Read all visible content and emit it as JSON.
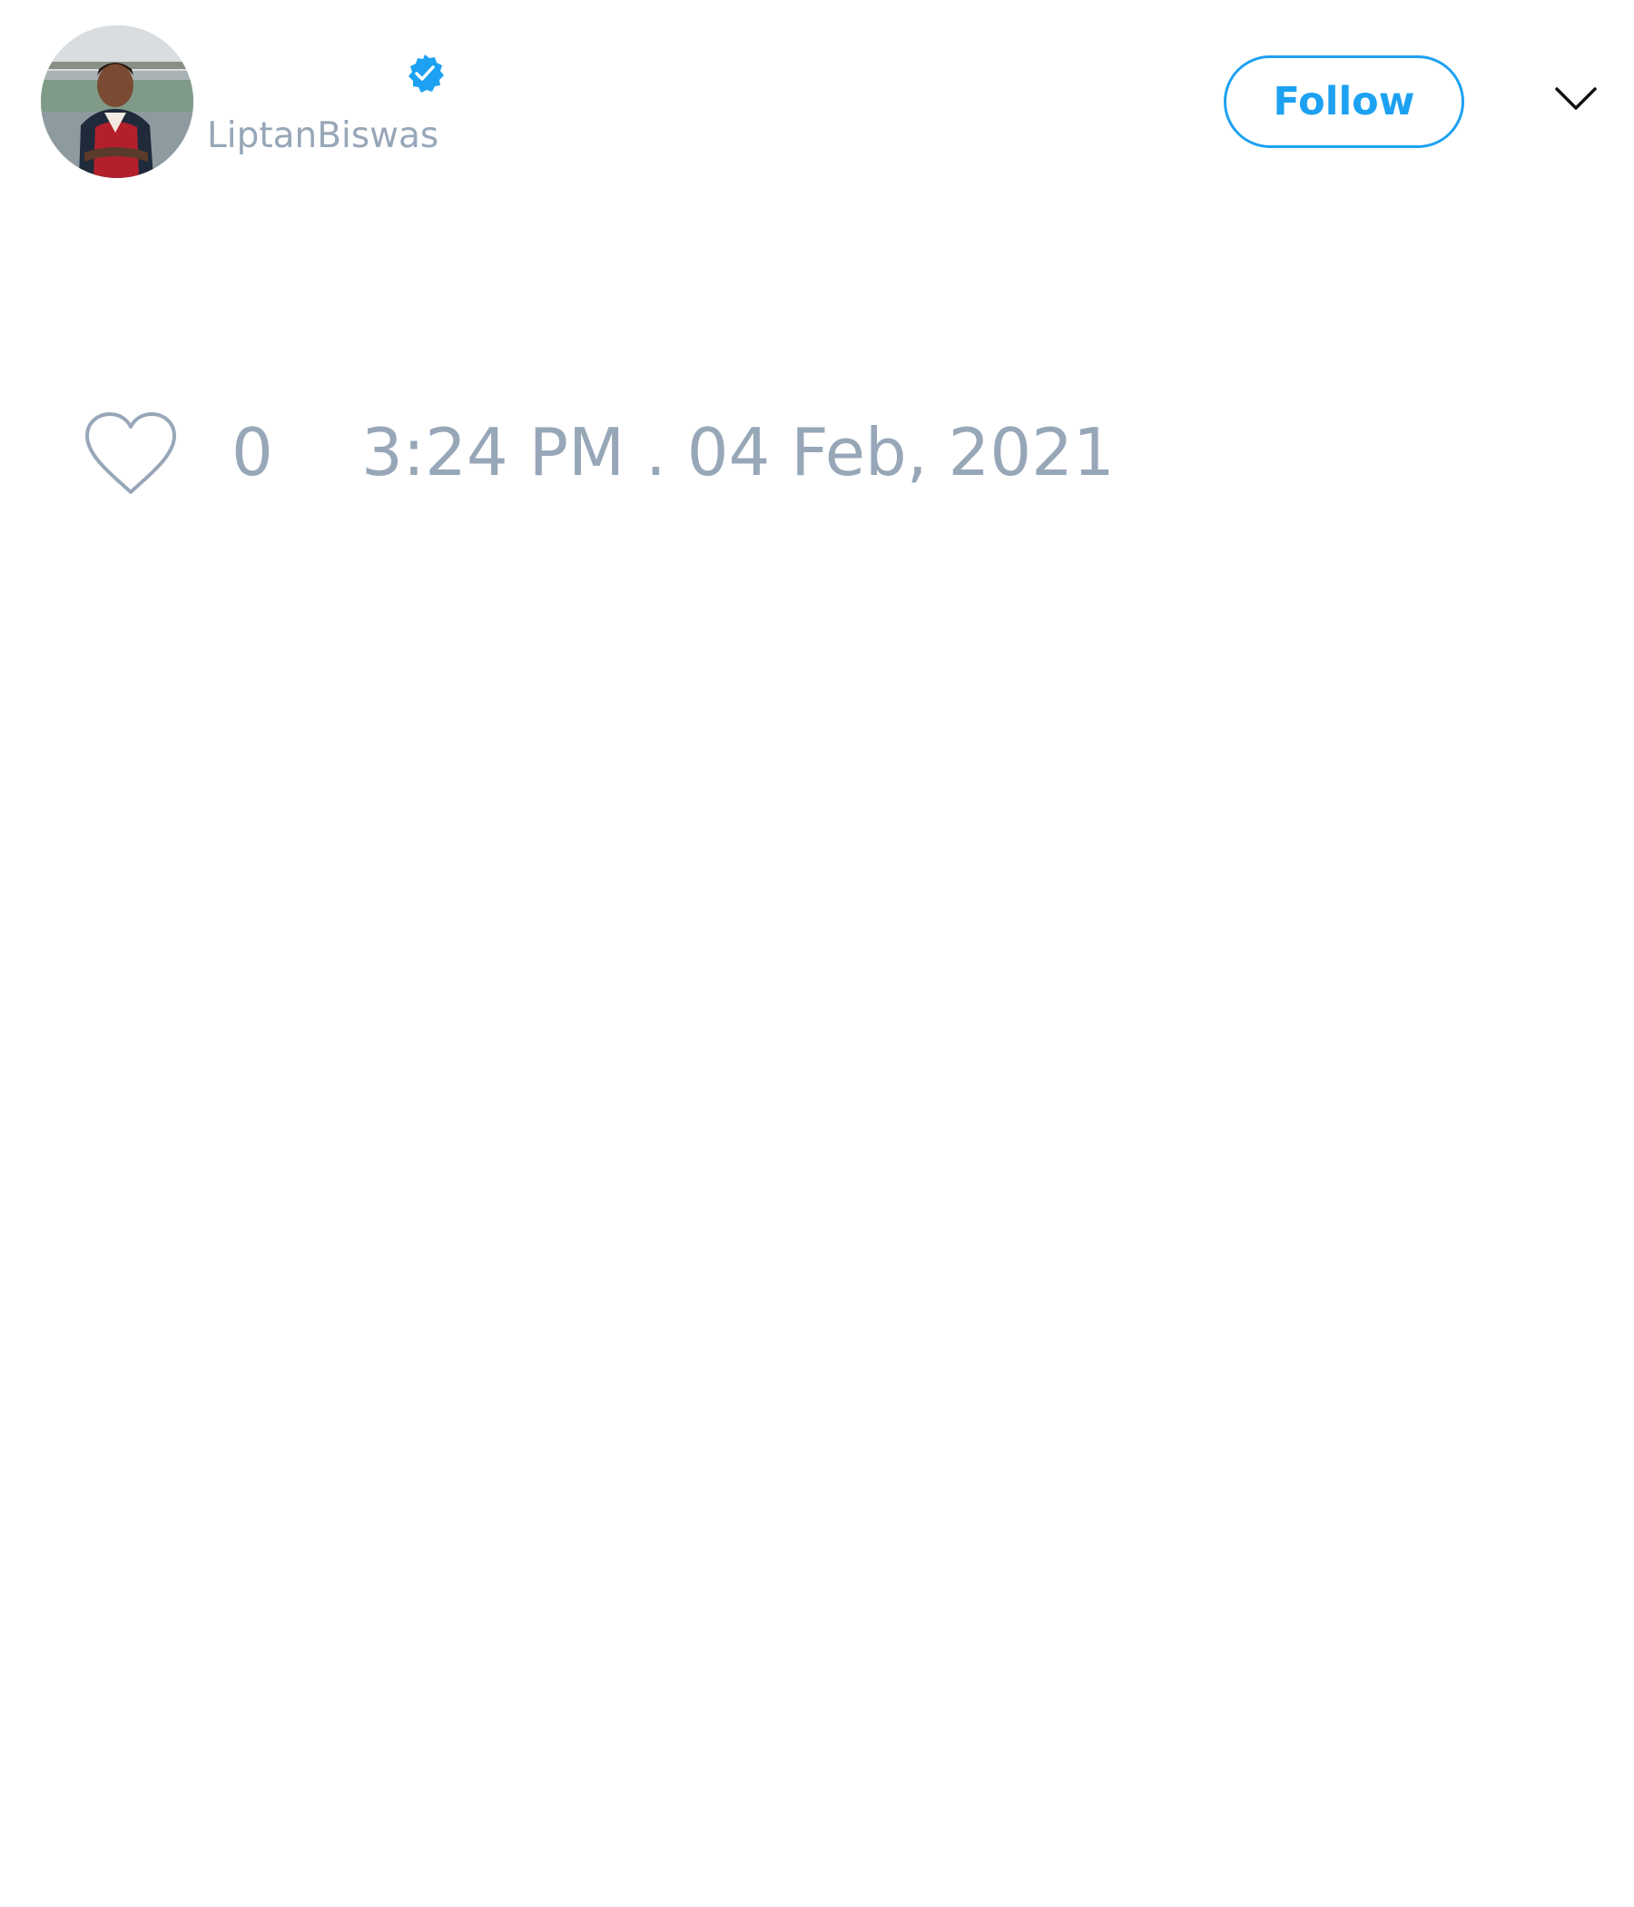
{
  "author": {
    "display_name": "",
    "handle": "LiptanBiswas",
    "verified": true,
    "avatar_icon": "user-photo"
  },
  "actions": {
    "follow_label": "Follow",
    "more_icon": "chevron-down-icon"
  },
  "engagement": {
    "like_icon": "heart-outline-icon",
    "like_count": "0",
    "timestamp": "3:24 PM . 04 Feb, 2021"
  },
  "colors": {
    "accent": "#1da1f2",
    "muted_text": "#97a7b8",
    "background": "#ffffff"
  }
}
